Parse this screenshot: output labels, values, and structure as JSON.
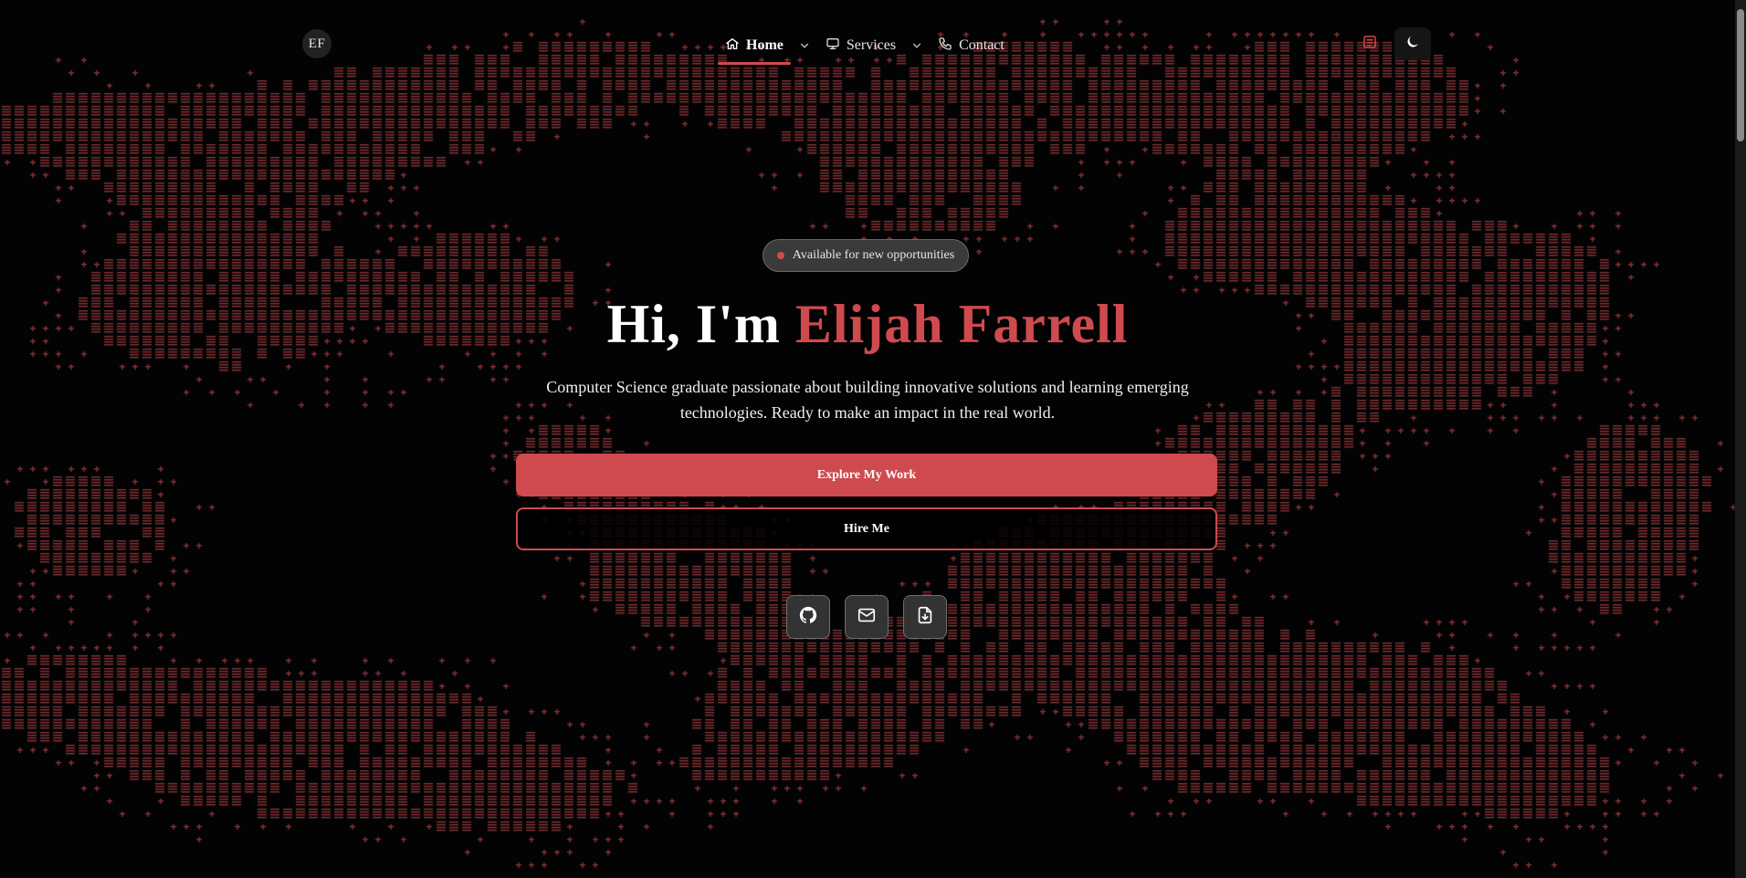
{
  "brand": {
    "initials": "EF"
  },
  "nav": {
    "items": [
      {
        "label": "Home",
        "icon": "home-icon",
        "active": true,
        "has_dropdown": true
      },
      {
        "label": "Services",
        "icon": "monitor-icon",
        "active": false,
        "has_dropdown": true
      },
      {
        "label": "Contact",
        "icon": "phone-icon",
        "active": false,
        "has_dropdown": false
      }
    ],
    "actions": [
      {
        "icon": "book-icon"
      },
      {
        "icon": "moon-icon"
      }
    ]
  },
  "hero": {
    "badge": "Available for new opportunities",
    "greeting": "Hi, I'm",
    "name": "Elijah Farrell",
    "subtitle": "Computer Science graduate passionate about building innovative solutions and learning emerging technologies. Ready to make an impact in the real world.",
    "primary_cta": "Explore My Work",
    "secondary_cta": "Hire Me",
    "socials": [
      {
        "icon": "github-icon"
      },
      {
        "icon": "mail-icon"
      },
      {
        "icon": "download-file-icon"
      }
    ]
  },
  "colors": {
    "accent": "#cf4a4f",
    "background": "#030303",
    "pattern": "#8c3438"
  }
}
